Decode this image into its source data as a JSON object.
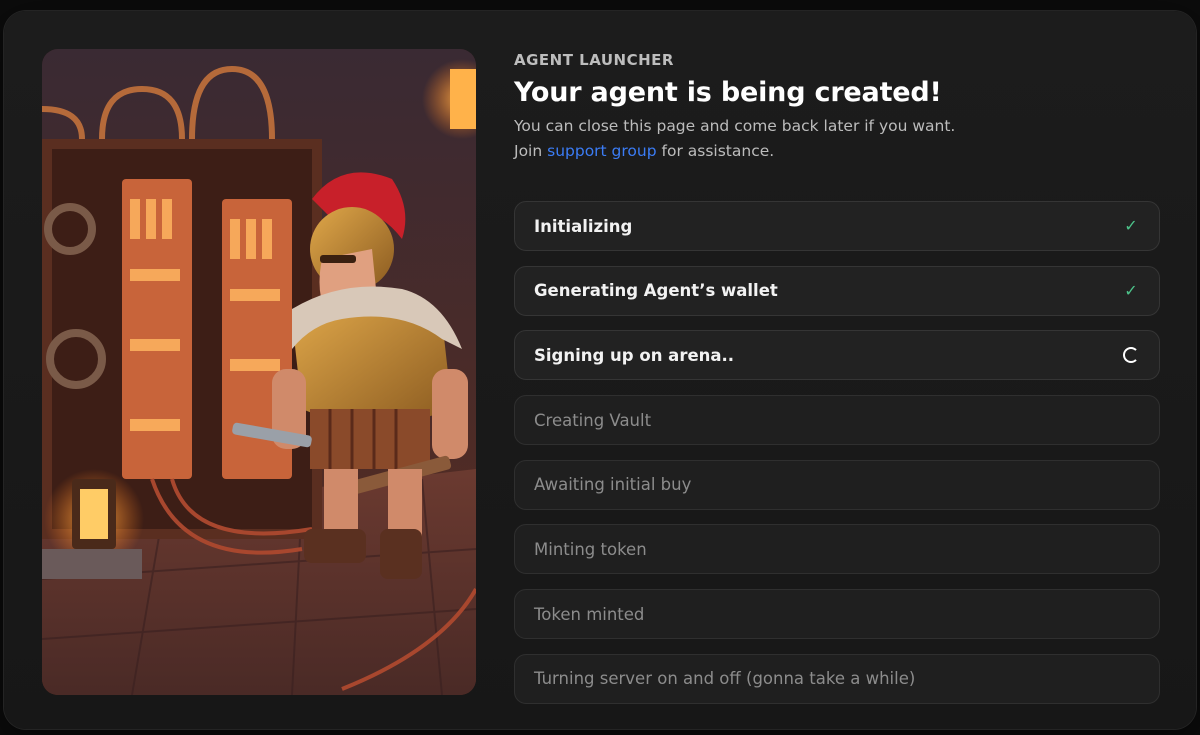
{
  "header": {
    "eyebrow": "AGENT LAUNCHER",
    "title": "Your agent is being created!",
    "subtitle_line1": "You can close this page and come back later if you want.",
    "subtitle_join": "Join",
    "subtitle_link": "support group",
    "subtitle_end": "for assistance."
  },
  "image": {
    "description": "roman-gladiator-with-wrench-in-server-room-illustration"
  },
  "steps": [
    {
      "label": "Initializing",
      "status": "done"
    },
    {
      "label": "Generating Agent’s wallet",
      "status": "done"
    },
    {
      "label": "Signing up on arena..",
      "status": "in-progress"
    },
    {
      "label": "Creating Vault",
      "status": "pending"
    },
    {
      "label": "Awaiting initial buy",
      "status": "pending"
    },
    {
      "label": "Minting token",
      "status": "pending"
    },
    {
      "label": "Token minted",
      "status": "pending"
    },
    {
      "label": "Turning server on and off (gonna take a while)",
      "status": "pending"
    }
  ],
  "icons": {
    "done": "check-icon",
    "in-progress": "spinner-icon"
  },
  "colors": {
    "accent_link": "#3b7cf5",
    "check": "#4cc38a",
    "background": "#1a1a1a"
  }
}
